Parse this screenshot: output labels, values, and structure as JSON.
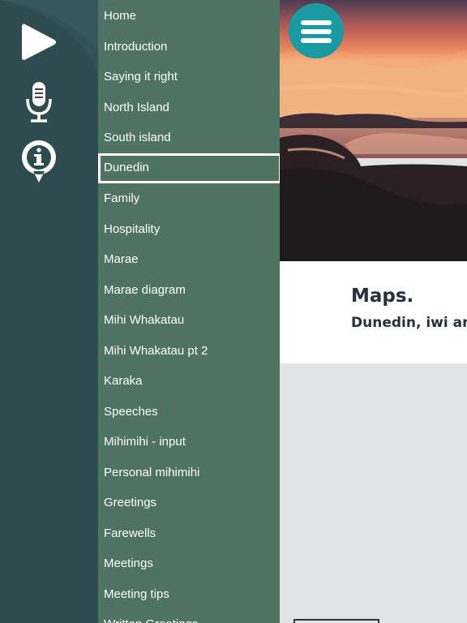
{
  "rail": {
    "icons": [
      "play-icon",
      "microphone-icon",
      "info-icon"
    ],
    "colors": {
      "background": "#2e4b4f",
      "icon": "#ffffff"
    }
  },
  "menu": {
    "active_index": 5,
    "items": [
      "Home",
      "Introduction",
      "Saying it right",
      "North Island",
      "South island",
      "Dunedin",
      "Family",
      "Hospitality",
      "Marae",
      "Marae diagram",
      "Mihi Whakatau",
      "Mihi Whakatau pt 2",
      "Karaka",
      "Speeches",
      "Mihimihi - input",
      "Personal mihimihi",
      "Greetings",
      "Farewells",
      "Meetings",
      "Meeting tips",
      "Written Greetings"
    ],
    "colors": {
      "background": "#4f7362",
      "text": "#ffffff"
    }
  },
  "header": {
    "menu_icon": "hamburger-icon",
    "accent": "#1a9aa3"
  },
  "content": {
    "title": "Maps.",
    "subtitle": "Dunedin, iwi and",
    "hero_image": "sunset-coastline-photo"
  }
}
